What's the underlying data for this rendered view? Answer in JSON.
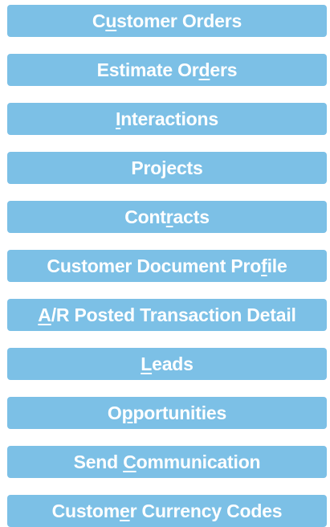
{
  "menu": {
    "buttons": [
      {
        "pre": "C",
        "key": "u",
        "post": "stomer Orders"
      },
      {
        "pre": "Estimate Or",
        "key": "d",
        "post": "ers"
      },
      {
        "pre": "",
        "key": "I",
        "post": "nteractions"
      },
      {
        "pre": "Pro",
        "key": "j",
        "post": "ects"
      },
      {
        "pre": "Cont",
        "key": "r",
        "post": "acts"
      },
      {
        "pre": "Customer Document Pro",
        "key": "f",
        "post": "ile"
      },
      {
        "pre": "",
        "key": "A",
        "post": "/R Posted Transaction Detail"
      },
      {
        "pre": "",
        "key": "L",
        "post": "eads"
      },
      {
        "pre": "O",
        "key": "p",
        "post": "portunities"
      },
      {
        "pre": "Send ",
        "key": "C",
        "post": "ommunication"
      },
      {
        "pre": "Custom",
        "key": "e",
        "post": "r Currency Codes"
      }
    ],
    "colors": {
      "button_bg": "#7cc0e6",
      "button_text": "#ffffff"
    }
  }
}
